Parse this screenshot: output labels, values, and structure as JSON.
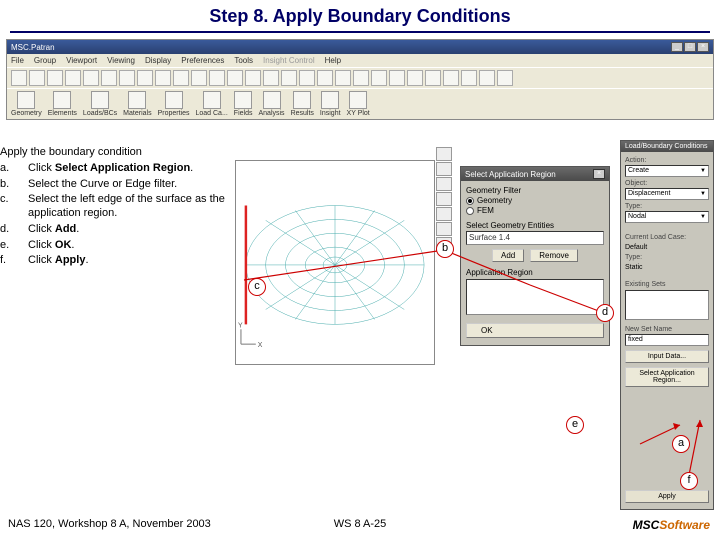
{
  "title": "Step 8. Apply Boundary Conditions",
  "toolbar": {
    "app_name": "MSC.Patran",
    "menus": [
      "File",
      "Group",
      "Viewport",
      "Viewing",
      "Display",
      "Preferences",
      "Tools",
      "Insight Control",
      "Help"
    ],
    "categories": [
      "Geometry",
      "Elements",
      "Loads/BCs",
      "Materials",
      "Properties",
      "Load Ca...",
      "Fields",
      "Analysis",
      "Results",
      "Insight",
      "XY Plot"
    ]
  },
  "instructions": {
    "lead": "Apply the boundary condition",
    "items": [
      {
        "letter": "a.",
        "pre": "Click ",
        "bold": "Select Application Region",
        "post": "."
      },
      {
        "letter": "b.",
        "pre": "Select the Curve or Edge filter.",
        "bold": "",
        "post": ""
      },
      {
        "letter": "c.",
        "pre": "Select the left edge of the surface as the application region.",
        "bold": "",
        "post": ""
      },
      {
        "letter": "d.",
        "pre": "Click ",
        "bold": "Add",
        "post": "."
      },
      {
        "letter": "e.",
        "pre": "Click ",
        "bold": "OK",
        "post": "."
      },
      {
        "letter": "f.",
        "pre": "Click ",
        "bold": "Apply",
        "post": "."
      }
    ]
  },
  "sar_panel": {
    "title": "Select Application Region",
    "filter_label": "Geometry Filter",
    "filter_geometry": "Geometry",
    "filter_fem": "FEM",
    "select_label": "Select Geometry Entities",
    "select_value": "Surface 1.4",
    "add": "Add",
    "remove": "Remove",
    "region_label": "Application Region",
    "ok": "OK"
  },
  "lbc_panel": {
    "title": "Load/Boundary Conditions",
    "action_label": "Action:",
    "action_value": "Create",
    "object_label": "Object:",
    "object_value": "Displacement",
    "type_label": "Type:",
    "type_value": "Nodal",
    "curloadcase_label": "Current Load Case:",
    "curloadcase_value": "Default",
    "lctype_label": "Type:",
    "lctype_value": "Static",
    "existing_label": "Existing Sets",
    "newset_label": "New Set Name",
    "newset_value": "fixed",
    "input_data": "Input Data...",
    "sel_region": "Select Application Region...",
    "apply": "Apply"
  },
  "callouts": {
    "a": "a",
    "b": "b",
    "c": "c",
    "d": "d",
    "e": "e",
    "f": "f"
  },
  "footer": {
    "left": "NAS 120, Workshop 8 A, November 2003",
    "center": "WS 8 A-25"
  },
  "logo": {
    "msc": "MSC",
    "sw": "Software"
  }
}
